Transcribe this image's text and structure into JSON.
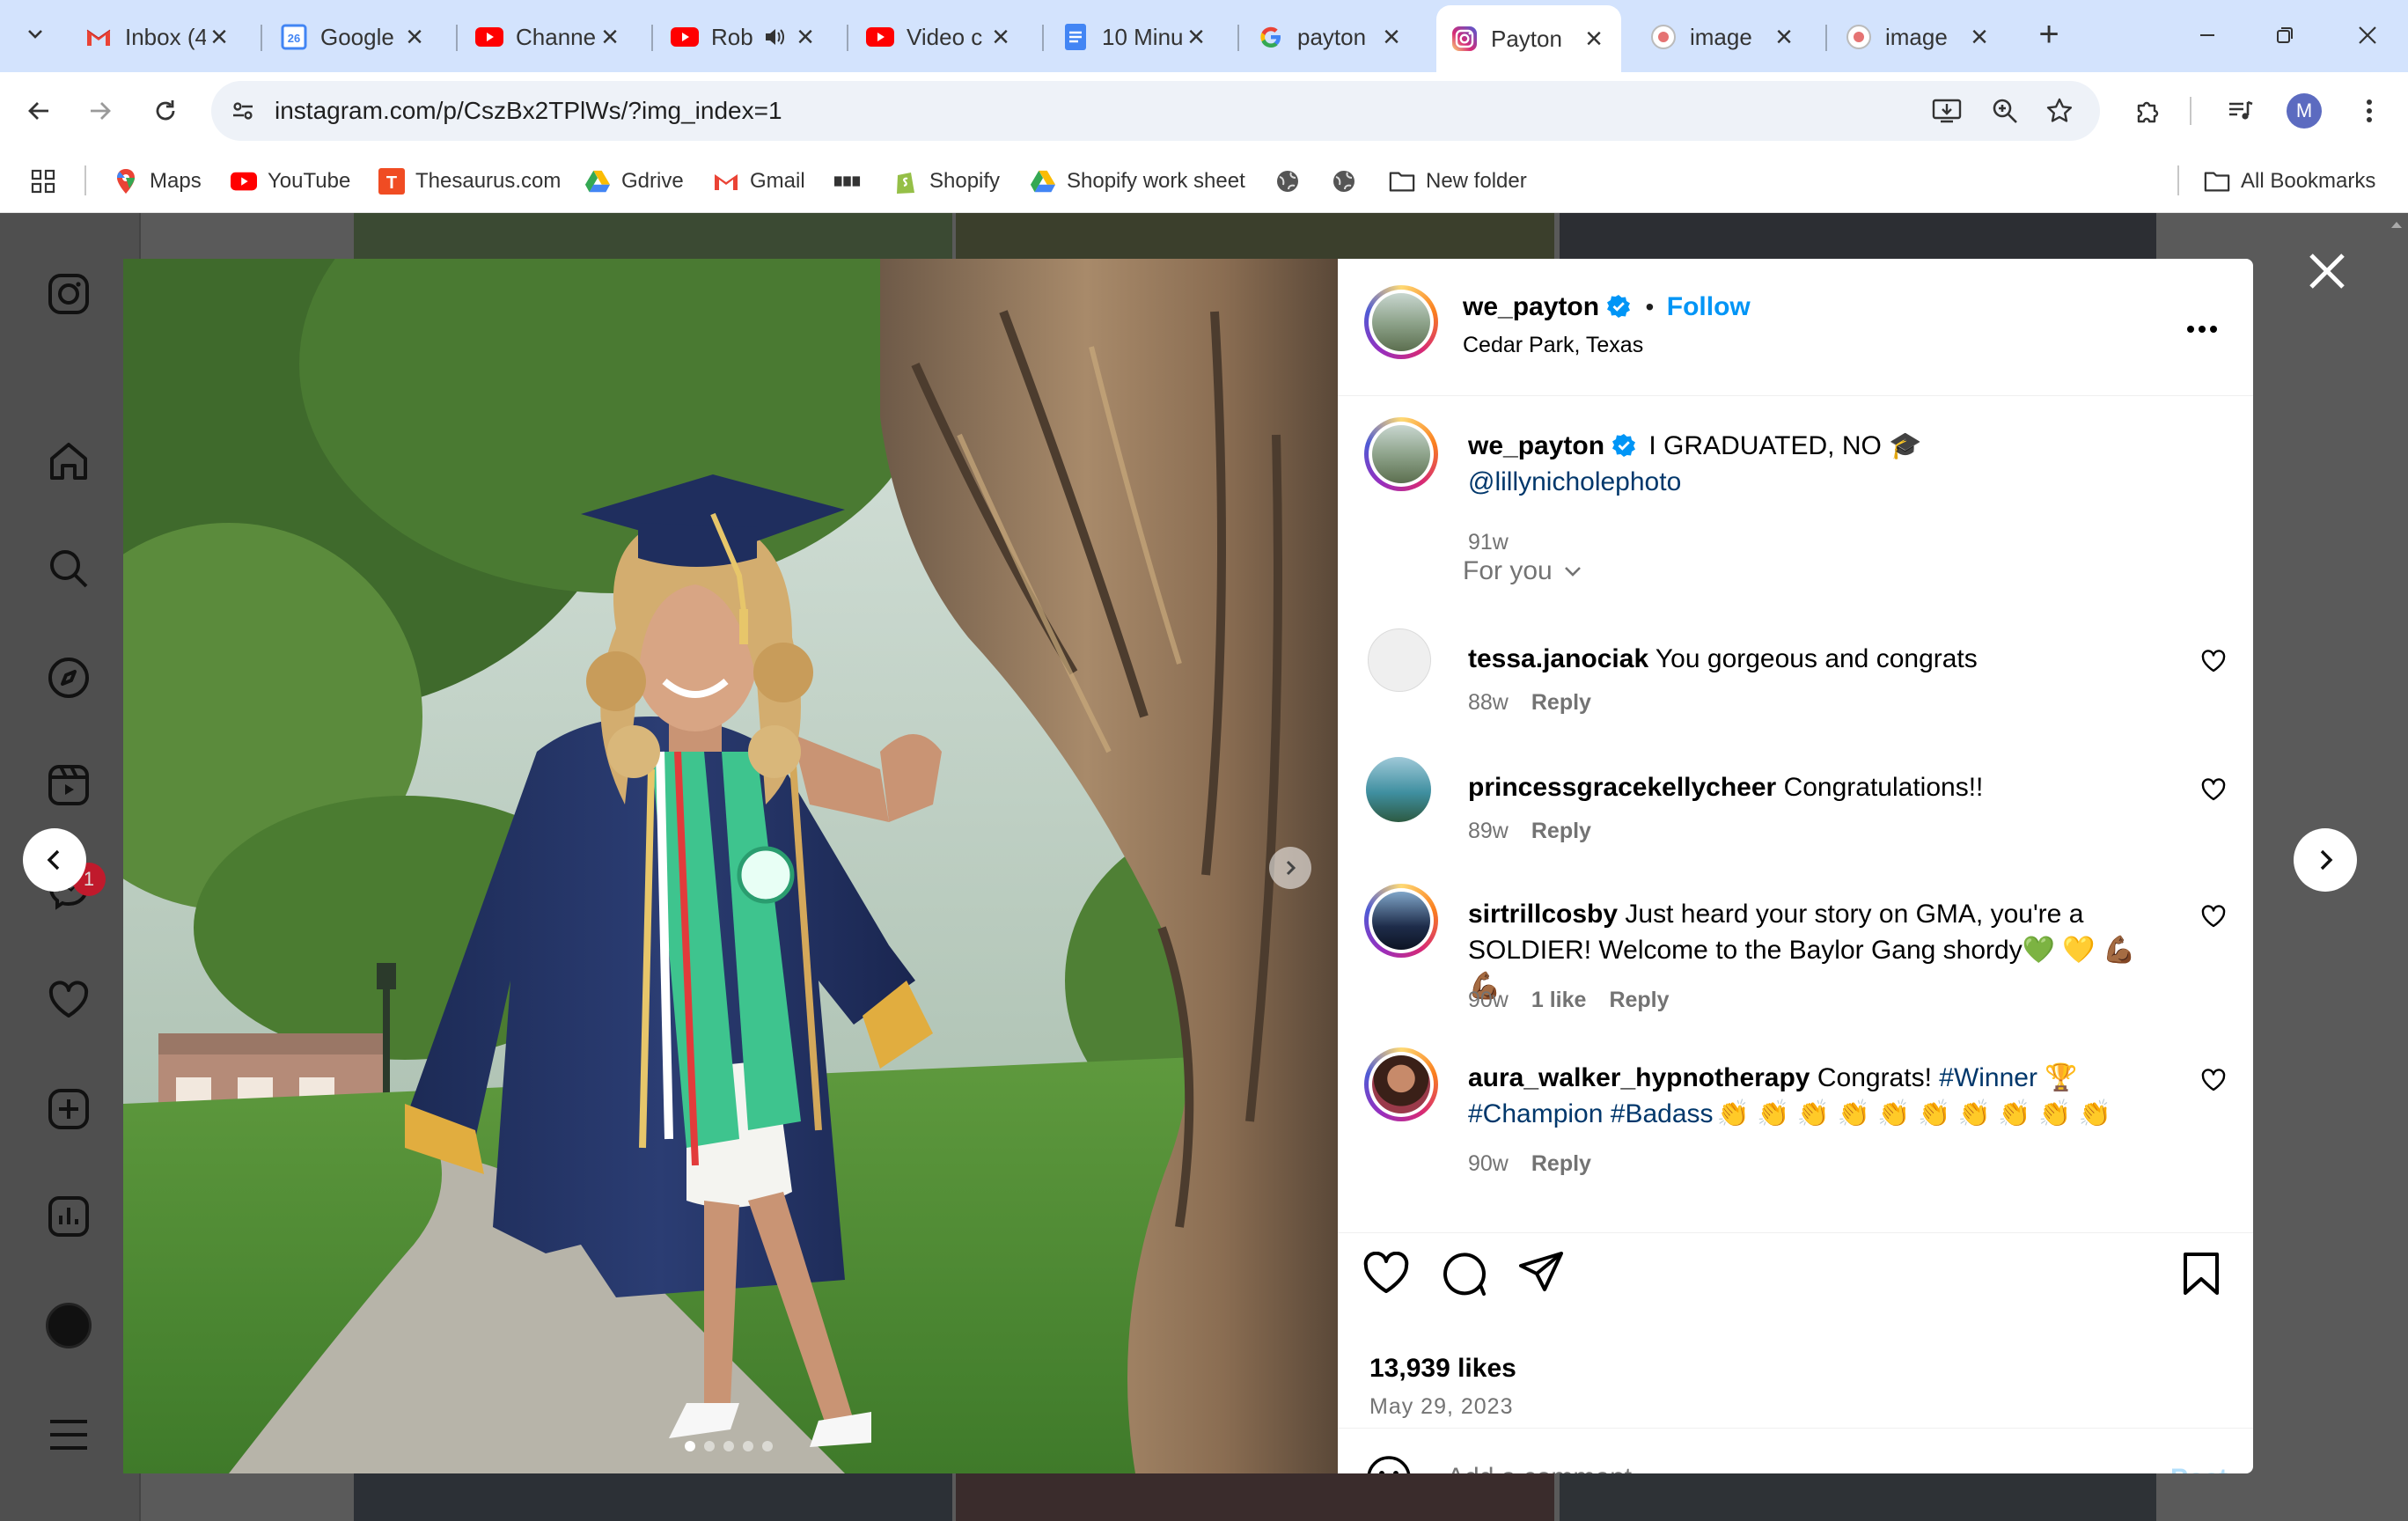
{
  "browser": {
    "tabs": [
      {
        "title": "Inbox (4",
        "icon": "gmail-icon"
      },
      {
        "title": "Google",
        "icon": "google-calendar-icon"
      },
      {
        "title": "Channe",
        "icon": "youtube-icon"
      },
      {
        "title": "Rob",
        "icon": "youtube-icon"
      },
      {
        "title": "Video c",
        "icon": "youtube-icon"
      },
      {
        "title": "10 Minu",
        "icon": "google-docs-icon"
      },
      {
        "title": "payton",
        "icon": "google-icon"
      },
      {
        "title": "Payton",
        "icon": "instagram-icon"
      },
      {
        "title": "image",
        "icon": "image-tab-icon"
      },
      {
        "title": "image",
        "icon": "image-tab-icon"
      }
    ],
    "active_tab": 7,
    "url": "instagram.com/p/CszBx2TPlWs/?img_index=1",
    "profile_initial": "M",
    "bookmarks": [
      {
        "label": "Maps"
      },
      {
        "label": "YouTube"
      },
      {
        "label": "Thesaurus.com"
      },
      {
        "label": "Gdrive"
      },
      {
        "label": "Gmail"
      },
      {
        "label": ""
      },
      {
        "label": "Shopify"
      },
      {
        "label": "Shopify work sheet"
      },
      {
        "label": ""
      },
      {
        "label": ""
      },
      {
        "label": "New folder"
      }
    ],
    "all_bookmarks": "All Bookmarks"
  },
  "sidebar": {
    "notification_count": "1"
  },
  "post": {
    "username": "we_payton",
    "follow_label": "Follow",
    "dot": "•",
    "location": "Cedar Park, Texas",
    "caption_text": "I GRADUATED, NO 🎓",
    "caption_mention": "@lillynicholephoto",
    "caption_age": "91w",
    "sort_label": "For you",
    "comments": [
      {
        "user": "tessa.janociak",
        "text": "You gorgeous and congrats",
        "age": "88w",
        "likes": "",
        "reply": "Reply"
      },
      {
        "user": "princessgracekellycheer",
        "text": "Congratulations!!",
        "age": "89w",
        "likes": "",
        "reply": "Reply"
      },
      {
        "user": "sirtrillcosby",
        "text": "Just heard your story on GMA, you're a SOLDIER! Welcome to the Baylor Gang shordy💚 💛 💪🏾 💪🏾",
        "age": "90w",
        "likes": "1 like",
        "reply": "Reply"
      },
      {
        "user": "aura_walker_hypnotherapy",
        "text": "Congrats!",
        "tags": "#Winner",
        "trophy": "🏆",
        "tags2": "#Champion #Badass",
        "claps": "👏 👏 👏 👏 👏 👏 👏 👏 👏 👏",
        "age": "90w",
        "reply": "Reply"
      }
    ],
    "likes": "13,939 likes",
    "date": "May 29, 2023",
    "comment_placeholder": "Add a comment...",
    "post_label": "Post",
    "carousel_count": 5,
    "carousel_index": 0
  },
  "colors": {
    "accent": "#0095f6",
    "verified": "#0095f6",
    "tabstrip": "#d3e3fd"
  }
}
